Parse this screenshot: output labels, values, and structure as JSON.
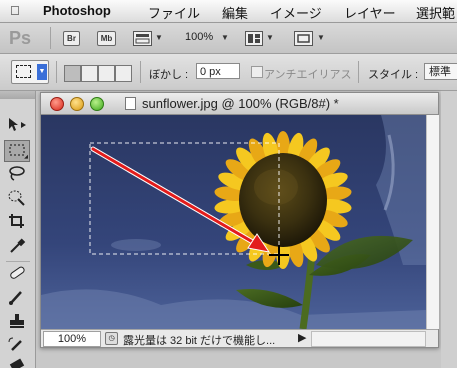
{
  "menubar": {
    "apple_glyph": "",
    "app_name": "Photoshop",
    "items": [
      "ファイル",
      "編集",
      "イメージ",
      "レイヤー",
      "選択範"
    ]
  },
  "appbar": {
    "logo": "Ps",
    "bridge_button": "Br",
    "minibridge_button": "Mb",
    "zoom_value": "100%"
  },
  "options": {
    "feather_label": "ぼかし :",
    "feather_value": "0 px",
    "antialias_label": "アンチエイリアス",
    "style_label": "スタイル :",
    "style_value": "標準"
  },
  "document": {
    "title": "sunflower.jpg @ 100% (RGB/8#) *",
    "zoom": "100%",
    "status_text": "露光量は 32 bit だけで機能し..."
  },
  "colors": {
    "sky": "#2f3d6a",
    "selection_arrow": "#e31c1c",
    "petals": "#f2c01c",
    "accent_blue": "#3a6fd8"
  }
}
